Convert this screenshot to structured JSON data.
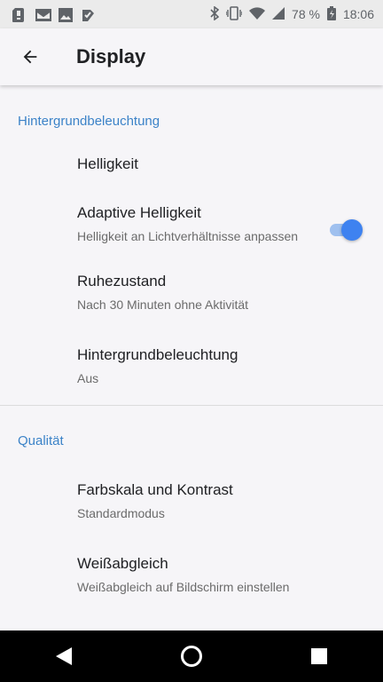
{
  "status_bar": {
    "battery_percent": "78 %",
    "time": "18:06",
    "left_icons": [
      "sd-card-icon",
      "mail-icon",
      "image-icon",
      "checkmark-icon"
    ],
    "right_icons": [
      "bluetooth-icon",
      "vibrate-icon",
      "wifi-icon",
      "signal-icon",
      "battery-icon"
    ]
  },
  "app_bar": {
    "title": "Display"
  },
  "sections": [
    {
      "header": "Hintergrundbeleuchtung",
      "items": [
        {
          "title": "Helligkeit"
        },
        {
          "title": "Adaptive Helligkeit",
          "subtitle": "Helligkeit an Lichtverhältnisse anpassen",
          "toggle_on": true
        },
        {
          "title": "Ruhezustand",
          "subtitle": "Nach 30 Minuten ohne Aktivität"
        },
        {
          "title": "Hintergrundbeleuchtung",
          "subtitle": "Aus"
        }
      ]
    },
    {
      "header": "Qualität",
      "items": [
        {
          "title": "Farbskala und Kontrast",
          "subtitle": "Standardmodus"
        },
        {
          "title": "Weißabgleich",
          "subtitle": "Weißabgleich auf Bildschirm einstellen"
        }
      ]
    }
  ],
  "colors": {
    "accent": "#3c83c8",
    "toggle_on": "#3e82f0",
    "background": "#f6f5f8"
  }
}
